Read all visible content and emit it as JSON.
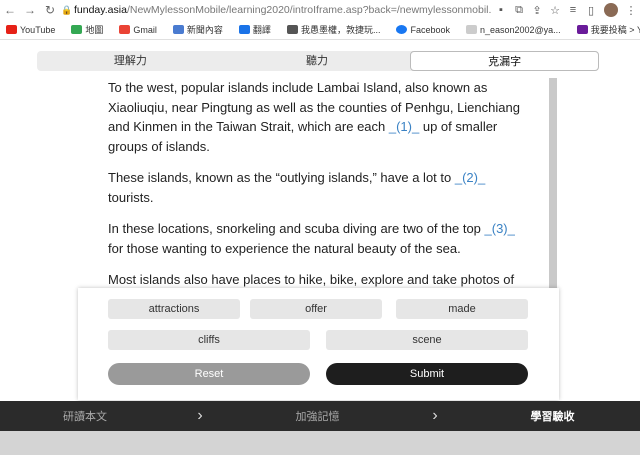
{
  "browser": {
    "url_host": "funday.asia",
    "url_path": "/NewMylessonMobile/learning2020/introIframe.asp?back=/newmylessonmobil..."
  },
  "bookmarks": [
    {
      "label": "YouTube",
      "color": "#e62117"
    },
    {
      "label": "地圖",
      "color": "#34a853"
    },
    {
      "label": "Gmail",
      "color": "#ea4335"
    },
    {
      "label": "新聞內容",
      "color": "#4a7bd0"
    },
    {
      "label": "翻譯",
      "color": "#1a73e8"
    },
    {
      "label": "我愚墨權，敦捷玩...",
      "color": "#555555"
    },
    {
      "label": "Facebook",
      "color": "#1877f2"
    },
    {
      "label": "n_eason2002@ya...",
      "color": "#666666"
    },
    {
      "label": "我要投稿 > Yahoo...",
      "color": "#6a1b9a"
    }
  ],
  "tabs": [
    "理解力",
    "聽力",
    "克漏字"
  ],
  "passage": {
    "p1_a": "To the west, popular islands include Lambai Island, also known as Xiaoliuqiu, near Pingtung as well as the counties of Penhgu, Lienchiang and Kinmen in the Taiwan Strait, which are each ",
    "p1_blank": "_(1)_",
    "p1_b": " up of smaller groups of islands.",
    "p2_a": "These islands, known as the “outlying islands,” have a lot to ",
    "p2_blank": "_(2)_",
    "p2_b": " tourists.",
    "p3_a": "In these locations, snorkeling and scuba diving are two of the top ",
    "p3_blank": "_(3)_",
    "p3_b": " for those wanting to experience the natural beauty of the sea.",
    "p4": "Most islands also have places to hike, bike, explore and take photos of the"
  },
  "choices": [
    "attractions",
    "offer",
    "made",
    "cliffs",
    "scene"
  ],
  "buttons": {
    "reset": "Reset",
    "submit": "Submit"
  },
  "bottom_nav": {
    "item1": "研讀本文",
    "item2": "加強記憶",
    "item3": "學習驗收"
  }
}
